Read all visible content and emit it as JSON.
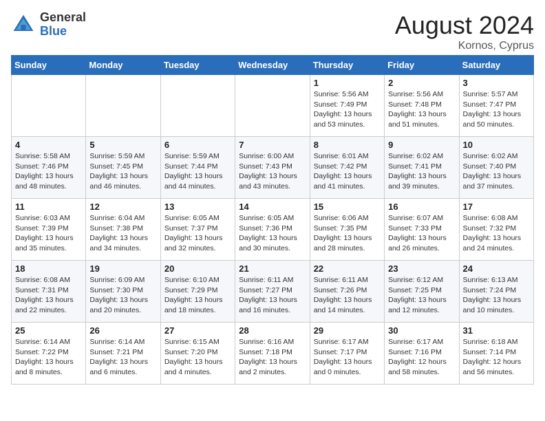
{
  "logo": {
    "general": "General",
    "blue": "Blue"
  },
  "title": "August 2024",
  "subtitle": "Kornos, Cyprus",
  "days_of_week": [
    "Sunday",
    "Monday",
    "Tuesday",
    "Wednesday",
    "Thursday",
    "Friday",
    "Saturday"
  ],
  "weeks": [
    [
      {
        "day": "",
        "info": ""
      },
      {
        "day": "",
        "info": ""
      },
      {
        "day": "",
        "info": ""
      },
      {
        "day": "",
        "info": ""
      },
      {
        "day": "1",
        "info": "Sunrise: 5:56 AM\nSunset: 7:49 PM\nDaylight: 13 hours\nand 53 minutes."
      },
      {
        "day": "2",
        "info": "Sunrise: 5:56 AM\nSunset: 7:48 PM\nDaylight: 13 hours\nand 51 minutes."
      },
      {
        "day": "3",
        "info": "Sunrise: 5:57 AM\nSunset: 7:47 PM\nDaylight: 13 hours\nand 50 minutes."
      }
    ],
    [
      {
        "day": "4",
        "info": "Sunrise: 5:58 AM\nSunset: 7:46 PM\nDaylight: 13 hours\nand 48 minutes."
      },
      {
        "day": "5",
        "info": "Sunrise: 5:59 AM\nSunset: 7:45 PM\nDaylight: 13 hours\nand 46 minutes."
      },
      {
        "day": "6",
        "info": "Sunrise: 5:59 AM\nSunset: 7:44 PM\nDaylight: 13 hours\nand 44 minutes."
      },
      {
        "day": "7",
        "info": "Sunrise: 6:00 AM\nSunset: 7:43 PM\nDaylight: 13 hours\nand 43 minutes."
      },
      {
        "day": "8",
        "info": "Sunrise: 6:01 AM\nSunset: 7:42 PM\nDaylight: 13 hours\nand 41 minutes."
      },
      {
        "day": "9",
        "info": "Sunrise: 6:02 AM\nSunset: 7:41 PM\nDaylight: 13 hours\nand 39 minutes."
      },
      {
        "day": "10",
        "info": "Sunrise: 6:02 AM\nSunset: 7:40 PM\nDaylight: 13 hours\nand 37 minutes."
      }
    ],
    [
      {
        "day": "11",
        "info": "Sunrise: 6:03 AM\nSunset: 7:39 PM\nDaylight: 13 hours\nand 35 minutes."
      },
      {
        "day": "12",
        "info": "Sunrise: 6:04 AM\nSunset: 7:38 PM\nDaylight: 13 hours\nand 34 minutes."
      },
      {
        "day": "13",
        "info": "Sunrise: 6:05 AM\nSunset: 7:37 PM\nDaylight: 13 hours\nand 32 minutes."
      },
      {
        "day": "14",
        "info": "Sunrise: 6:05 AM\nSunset: 7:36 PM\nDaylight: 13 hours\nand 30 minutes."
      },
      {
        "day": "15",
        "info": "Sunrise: 6:06 AM\nSunset: 7:35 PM\nDaylight: 13 hours\nand 28 minutes."
      },
      {
        "day": "16",
        "info": "Sunrise: 6:07 AM\nSunset: 7:33 PM\nDaylight: 13 hours\nand 26 minutes."
      },
      {
        "day": "17",
        "info": "Sunrise: 6:08 AM\nSunset: 7:32 PM\nDaylight: 13 hours\nand 24 minutes."
      }
    ],
    [
      {
        "day": "18",
        "info": "Sunrise: 6:08 AM\nSunset: 7:31 PM\nDaylight: 13 hours\nand 22 minutes."
      },
      {
        "day": "19",
        "info": "Sunrise: 6:09 AM\nSunset: 7:30 PM\nDaylight: 13 hours\nand 20 minutes."
      },
      {
        "day": "20",
        "info": "Sunrise: 6:10 AM\nSunset: 7:29 PM\nDaylight: 13 hours\nand 18 minutes."
      },
      {
        "day": "21",
        "info": "Sunrise: 6:11 AM\nSunset: 7:27 PM\nDaylight: 13 hours\nand 16 minutes."
      },
      {
        "day": "22",
        "info": "Sunrise: 6:11 AM\nSunset: 7:26 PM\nDaylight: 13 hours\nand 14 minutes."
      },
      {
        "day": "23",
        "info": "Sunrise: 6:12 AM\nSunset: 7:25 PM\nDaylight: 13 hours\nand 12 minutes."
      },
      {
        "day": "24",
        "info": "Sunrise: 6:13 AM\nSunset: 7:24 PM\nDaylight: 13 hours\nand 10 minutes."
      }
    ],
    [
      {
        "day": "25",
        "info": "Sunrise: 6:14 AM\nSunset: 7:22 PM\nDaylight: 13 hours\nand 8 minutes."
      },
      {
        "day": "26",
        "info": "Sunrise: 6:14 AM\nSunset: 7:21 PM\nDaylight: 13 hours\nand 6 minutes."
      },
      {
        "day": "27",
        "info": "Sunrise: 6:15 AM\nSunset: 7:20 PM\nDaylight: 13 hours\nand 4 minutes."
      },
      {
        "day": "28",
        "info": "Sunrise: 6:16 AM\nSunset: 7:18 PM\nDaylight: 13 hours\nand 2 minutes."
      },
      {
        "day": "29",
        "info": "Sunrise: 6:17 AM\nSunset: 7:17 PM\nDaylight: 13 hours\nand 0 minutes."
      },
      {
        "day": "30",
        "info": "Sunrise: 6:17 AM\nSunset: 7:16 PM\nDaylight: 12 hours\nand 58 minutes."
      },
      {
        "day": "31",
        "info": "Sunrise: 6:18 AM\nSunset: 7:14 PM\nDaylight: 12 hours\nand 56 minutes."
      }
    ]
  ]
}
